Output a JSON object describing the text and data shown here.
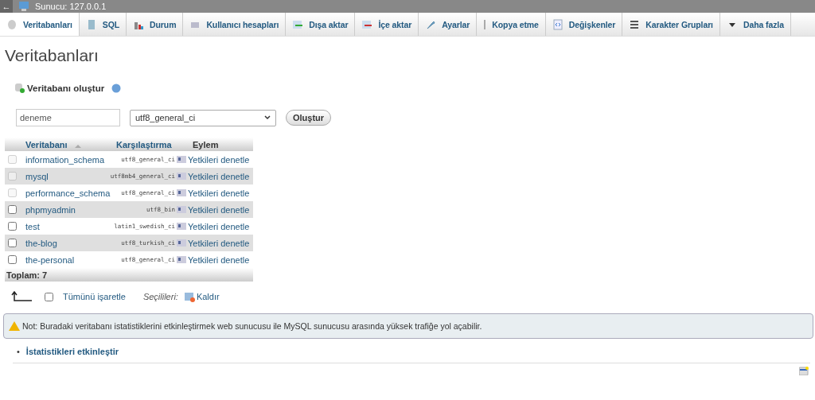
{
  "topbar": {
    "back": "←",
    "title": "Sunucu: 127.0.0.1"
  },
  "tabs": [
    {
      "label": "Veritabanları",
      "selected": true
    },
    {
      "label": "SQL",
      "selected": false
    },
    {
      "label": "Durum",
      "selected": false
    },
    {
      "label": "Kullanıcı hesapları",
      "selected": false
    },
    {
      "label": "Dışa aktar",
      "selected": false
    },
    {
      "label": "İçe aktar",
      "selected": false
    },
    {
      "label": "Ayarlar",
      "selected": false
    },
    {
      "label": "Kopya etme",
      "selected": false
    },
    {
      "label": "Değişkenler",
      "selected": false
    },
    {
      "label": "Karakter Grupları",
      "selected": false
    },
    {
      "label": "Daha fazla",
      "selected": false
    }
  ],
  "page_title": "Veritabanları",
  "create": {
    "heading": "Veritabanı oluştur",
    "name_value": "deneme",
    "collation_value": "utf8_general_ci",
    "button": "Oluştur"
  },
  "table": {
    "columns": [
      "Veritabanı",
      "Karşılaştırma",
      "Eylem"
    ],
    "rows": [
      {
        "name": "information_schema",
        "collation": "utf8_general_ci",
        "action": "Yetkileri denetle",
        "disabled": true,
        "checked": false
      },
      {
        "name": "mysql",
        "collation": "utf8mb4_general_ci",
        "action": "Yetkileri denetle",
        "disabled": true,
        "checked": false
      },
      {
        "name": "performance_schema",
        "collation": "utf8_general_ci",
        "action": "Yetkileri denetle",
        "disabled": true,
        "checked": false
      },
      {
        "name": "phpmyadmin",
        "collation": "utf8_bin",
        "action": "Yetkileri denetle",
        "disabled": false,
        "checked": false
      },
      {
        "name": "test",
        "collation": "latin1_swedish_ci",
        "action": "Yetkileri denetle",
        "disabled": false,
        "checked": false
      },
      {
        "name": "the-blog",
        "collation": "utf8_turkish_ci",
        "action": "Yetkileri denetle",
        "disabled": false,
        "checked": false
      },
      {
        "name": "the-personal",
        "collation": "utf8_general_ci",
        "action": "Yetkileri denetle",
        "disabled": false,
        "checked": false
      }
    ],
    "footer": "Toplam: 7"
  },
  "bulk": {
    "check_all": "Tümünü işaretle",
    "check_all_checked": false,
    "with_selected": "Seçilileri:",
    "drop": "Kaldır"
  },
  "notice": "Not: Buradaki veritabanı istatistiklerini etkinleştirmek web sunucusu ile MySQL sunucusu arasında yüksek trafiğe yol açabilir.",
  "links": [
    {
      "bullet": "•",
      "label": "İstatistikleri etkinleştir"
    }
  ]
}
